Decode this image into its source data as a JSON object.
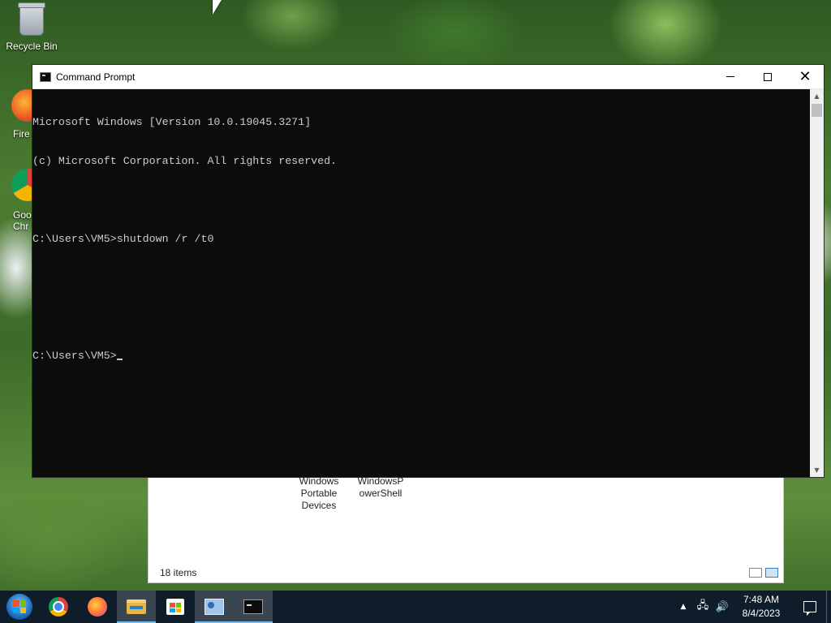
{
  "desktop": {
    "recycle_bin_label": "Recycle Bin",
    "firefox_label_partial": "Fire",
    "chrome_label_line1": "Goo",
    "chrome_label_line2": "Chr"
  },
  "explorer": {
    "items": [
      {
        "label_line1": "Windows",
        "label_line2": "Portable",
        "label_line3": "Devices"
      },
      {
        "label_line1": "WindowsP",
        "label_line2": "owerShell"
      }
    ],
    "status_count": "18 items"
  },
  "cmd": {
    "title": "Command Prompt",
    "lines": [
      "Microsoft Windows [Version 10.0.19045.3271]",
      "(c) Microsoft Corporation. All rights reserved.",
      "",
      "C:\\Users\\VM5>shutdown /r /t0",
      "",
      "",
      "C:\\Users\\VM5>"
    ],
    "controls": {
      "minimize": "minimize-icon",
      "maximize": "maximize-icon",
      "close": "✕"
    }
  },
  "taskbar": {
    "apps": [
      "start",
      "google-chrome",
      "firefox",
      "file-explorer",
      "microsoft-store",
      "control-panel",
      "command-prompt"
    ],
    "active_app": "command-prompt",
    "clock_time": "7:48 AM",
    "clock_date": "8/4/2023",
    "tray_chevron": "▲",
    "network_glyph": "🖧",
    "volume_glyph": "🔊"
  },
  "colors": {
    "console_bg": "#0c0c0c",
    "console_fg": "#cccccc",
    "taskbar_bg": "#0f1d2b",
    "active_underline": "#76b9ed"
  }
}
